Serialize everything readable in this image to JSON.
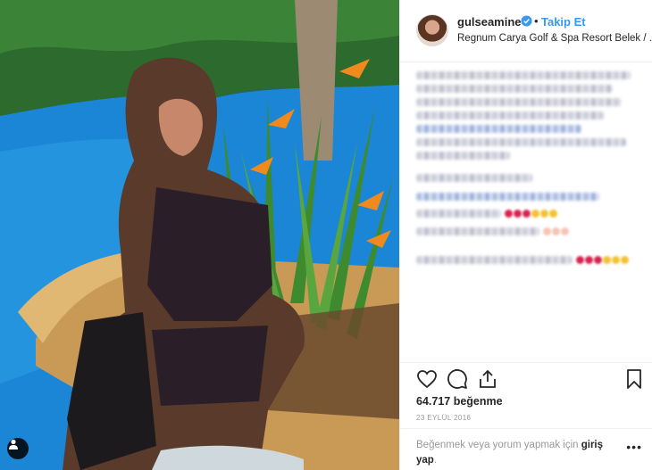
{
  "post": {
    "username": "gulseamine",
    "follow_label": "Takip Et",
    "separator": "•",
    "location": "Regnum Carya Golf & Spa Resort Belek / ...",
    "likes": "64.717 beğenme",
    "date": "23 EYLÜL 2016",
    "footer": {
      "prefix": "Beğenmek veya yorum yapmak için ",
      "login_label": "giriş yap",
      "suffix": ".",
      "more_label": "•••"
    }
  },
  "icons": {
    "verified": "verified-badge-icon",
    "like": "heart-icon",
    "comment": "comment-icon",
    "share": "share-icon",
    "save": "bookmark-icon",
    "user_tag": "user-tag-icon"
  },
  "colors": {
    "accent": "#3897f0",
    "text": "#262626",
    "muted": "#999999",
    "border": "#efefef"
  }
}
